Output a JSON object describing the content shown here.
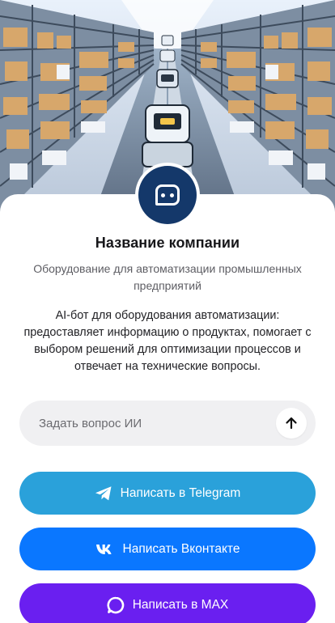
{
  "company": {
    "name": "Название компании",
    "subtitle": "Оборудование для автоматизации промышленных предприятий",
    "description": "AI-бот для оборудования автоматизации: предоставляет информацию о продуктах, помогает с выбором решений для оптимизации процессов и отвечает на технические вопросы.",
    "logo_icon": "chat-bot-icon"
  },
  "ask": {
    "placeholder": "Задать вопрос ИИ",
    "value": "",
    "send_icon": "arrow-up-icon"
  },
  "buttons": {
    "telegram": {
      "label": "Написать в Telegram",
      "icon": "telegram-icon",
      "color": "#2aa1da"
    },
    "vk": {
      "label": "Написать Вконтакте",
      "icon": "vk-icon",
      "color": "#0a77ff"
    },
    "max": {
      "label": "Написать в MAX",
      "icon": "max-messenger-icon",
      "color": "#6a1ff0"
    }
  },
  "colors": {
    "brand": "#14386a",
    "input_bg": "#f0f0f2"
  }
}
